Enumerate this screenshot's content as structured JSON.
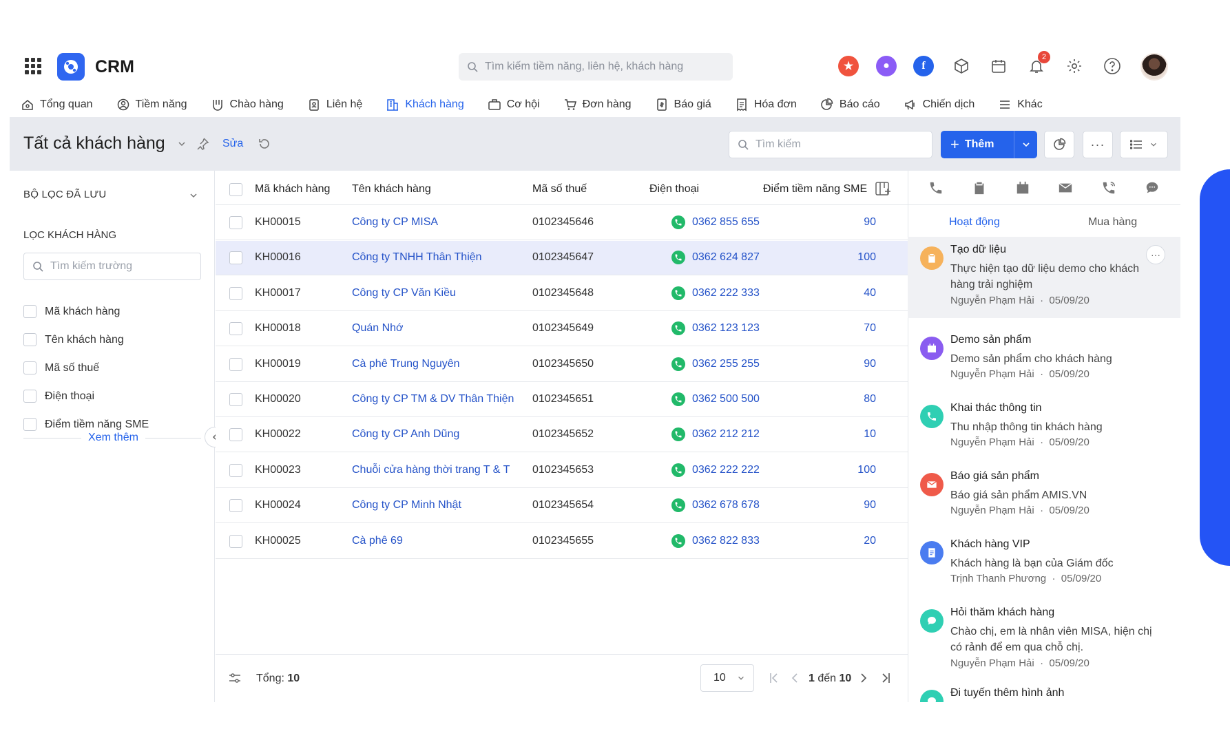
{
  "app": {
    "title": "CRM"
  },
  "global_search": {
    "placeholder": "Tìm kiếm tiềm năng, liên hệ, khách hàng"
  },
  "notifications": {
    "count": "2"
  },
  "nav": [
    {
      "label": "Tổng quan",
      "icon": "home-icon"
    },
    {
      "label": "Tiềm năng",
      "icon": "prospect-icon"
    },
    {
      "label": "Chào hàng",
      "icon": "offer-icon"
    },
    {
      "label": "Liên hệ",
      "icon": "contact-icon"
    },
    {
      "label": "Khách hàng",
      "icon": "building-icon",
      "active": true
    },
    {
      "label": "Cơ hội",
      "icon": "briefcase-icon"
    },
    {
      "label": "Đơn hàng",
      "icon": "cart-icon"
    },
    {
      "label": "Báo giá",
      "icon": "quote-icon"
    },
    {
      "label": "Hóa đơn",
      "icon": "invoice-icon"
    },
    {
      "label": "Báo cáo",
      "icon": "pie-chart-icon"
    },
    {
      "label": "Chiến dịch",
      "icon": "megaphone-icon"
    },
    {
      "label": "Khác",
      "icon": "menu-icon"
    }
  ],
  "header": {
    "title": "Tất cả khách hàng",
    "edit": "Sửa",
    "search_placeholder": "Tìm kiếm",
    "add_label": "Thêm"
  },
  "filters": {
    "saved_title": "BỘ LỌC ĐÃ LƯU",
    "filter_title": "LỌC KHÁCH HÀNG",
    "field_search_placeholder": "Tìm kiếm trường",
    "fields": [
      "Mã khách hàng",
      "Tên khách hàng",
      "Mã số thuế",
      "Điện thoại",
      "Điểm tiềm năng SME"
    ],
    "more": "Xem thêm"
  },
  "table": {
    "columns": [
      "Mã khách hàng",
      "Tên khách hàng",
      "Mã số thuế",
      "Điện thoại",
      "Điểm tiềm năng SME"
    ],
    "rows": [
      {
        "code": "KH00015",
        "name": "Công ty CP MISA",
        "tax": "0102345646",
        "phone": "0362 855 655",
        "score": "90"
      },
      {
        "code": "KH00016",
        "name": "Công ty TNHH Thân Thiện",
        "tax": "0102345647",
        "phone": "0362 624 827",
        "score": "100",
        "selected": true
      },
      {
        "code": "KH00017",
        "name": "Công ty CP Văn Kiều",
        "tax": "0102345648",
        "phone": "0362 222 333",
        "score": "40"
      },
      {
        "code": "KH00018",
        "name": "Quán Nhớ",
        "tax": "0102345649",
        "phone": "0362 123 123",
        "score": "70"
      },
      {
        "code": "KH00019",
        "name": "Cà phê Trung Nguyên",
        "tax": "0102345650",
        "phone": "0362 255 255",
        "score": "90"
      },
      {
        "code": "KH00020",
        "name": "Công ty CP TM & DV Thân Thiện",
        "tax": "0102345651",
        "phone": "0362 500 500",
        "score": "80"
      },
      {
        "code": "KH00022",
        "name": "Công ty CP Anh Dũng",
        "tax": "0102345652",
        "phone": "0362 212 212",
        "score": "10"
      },
      {
        "code": "KH00023",
        "name": "Chuỗi cửa hàng thời trang T & T",
        "tax": "0102345653",
        "phone": "0362 222 222",
        "score": "100"
      },
      {
        "code": "KH00024",
        "name": "Công ty CP Minh Nhật",
        "tax": "0102345654",
        "phone": "0362 678 678",
        "score": "90"
      },
      {
        "code": "KH00025",
        "name": "Cà phê 69",
        "tax": "0102345655",
        "phone": "0362 822 833",
        "score": "20"
      }
    ],
    "footer": {
      "total_label": "Tổng:",
      "total_value": "10",
      "page_size": "10",
      "range_prefix": "1",
      "range_mid": "đến",
      "range_end": "10"
    }
  },
  "activity_panel": {
    "tabs": [
      "Hoạt động",
      "Mua hàng"
    ],
    "items": [
      {
        "title": "Tạo dữ liệu",
        "desc": "Thực hiện tạo dữ liệu demo cho khách hàng trải nghiệm",
        "author": "Nguyễn Phạm Hải",
        "date": "05/09/20",
        "icon": "clipboard-icon",
        "color": "#f6b25b"
      },
      {
        "title": "Demo sản phẩm",
        "desc": "Demo sản phẩm cho khách hàng",
        "author": "Nguyễn Phạm Hải",
        "date": "05/09/20",
        "icon": "calendar-icon",
        "color": "#8a5cf0"
      },
      {
        "title": "Khai thác thông tin",
        "desc": "Thu nhập thông tin khách hàng",
        "author": "Nguyễn Phạm Hải",
        "date": "05/09/20",
        "icon": "phone-icon",
        "color": "#2fcfb3"
      },
      {
        "title": "Báo giá sản phẩm",
        "desc": "Báo giá sản phẩm AMIS.VN",
        "author": "Nguyễn Phạm Hải",
        "date": "05/09/20",
        "icon": "mail-icon",
        "color": "#ef5a4a"
      },
      {
        "title": "Khách hàng VIP",
        "desc": "Khách hàng là bạn của Giám đốc",
        "author": "Trịnh Thanh Phương",
        "date": "05/09/20",
        "icon": "note-icon",
        "color": "#4a7cf0"
      },
      {
        "title": "Hỏi thăm khách hàng",
        "desc": "Chào chị, em là nhân viên MISA, hiện chị có rảnh để em qua chỗ chị.",
        "author": "Nguyễn Phạm Hải",
        "date": "05/09/20",
        "icon": "chat-icon",
        "color": "#2fcfb3"
      },
      {
        "title": "Đi tuyến thêm hình ảnh",
        "desc": "",
        "author": "",
        "date": "",
        "icon": "chat-icon",
        "color": "#2fcfb3"
      }
    ]
  }
}
